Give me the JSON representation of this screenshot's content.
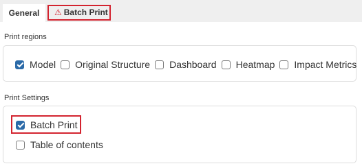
{
  "tabs": {
    "general": "General",
    "batch_print": "Batch Print",
    "batch_print_icon": "warning-triangle-icon"
  },
  "print_regions": {
    "label": "Print regions",
    "options": [
      {
        "label": "Model",
        "checked": true
      },
      {
        "label": "Original Structure",
        "checked": false
      },
      {
        "label": "Dashboard",
        "checked": false
      },
      {
        "label": "Heatmap",
        "checked": false
      },
      {
        "label": "Impact Metrics",
        "checked": false
      }
    ]
  },
  "print_settings": {
    "label": "Print Settings",
    "batch_print": {
      "label": "Batch Print",
      "checked": true
    },
    "table_of_contents": {
      "label": "Table of contents",
      "checked": false
    }
  },
  "colors": {
    "accent": "#2b6aa8",
    "highlight": "#d3232f"
  }
}
